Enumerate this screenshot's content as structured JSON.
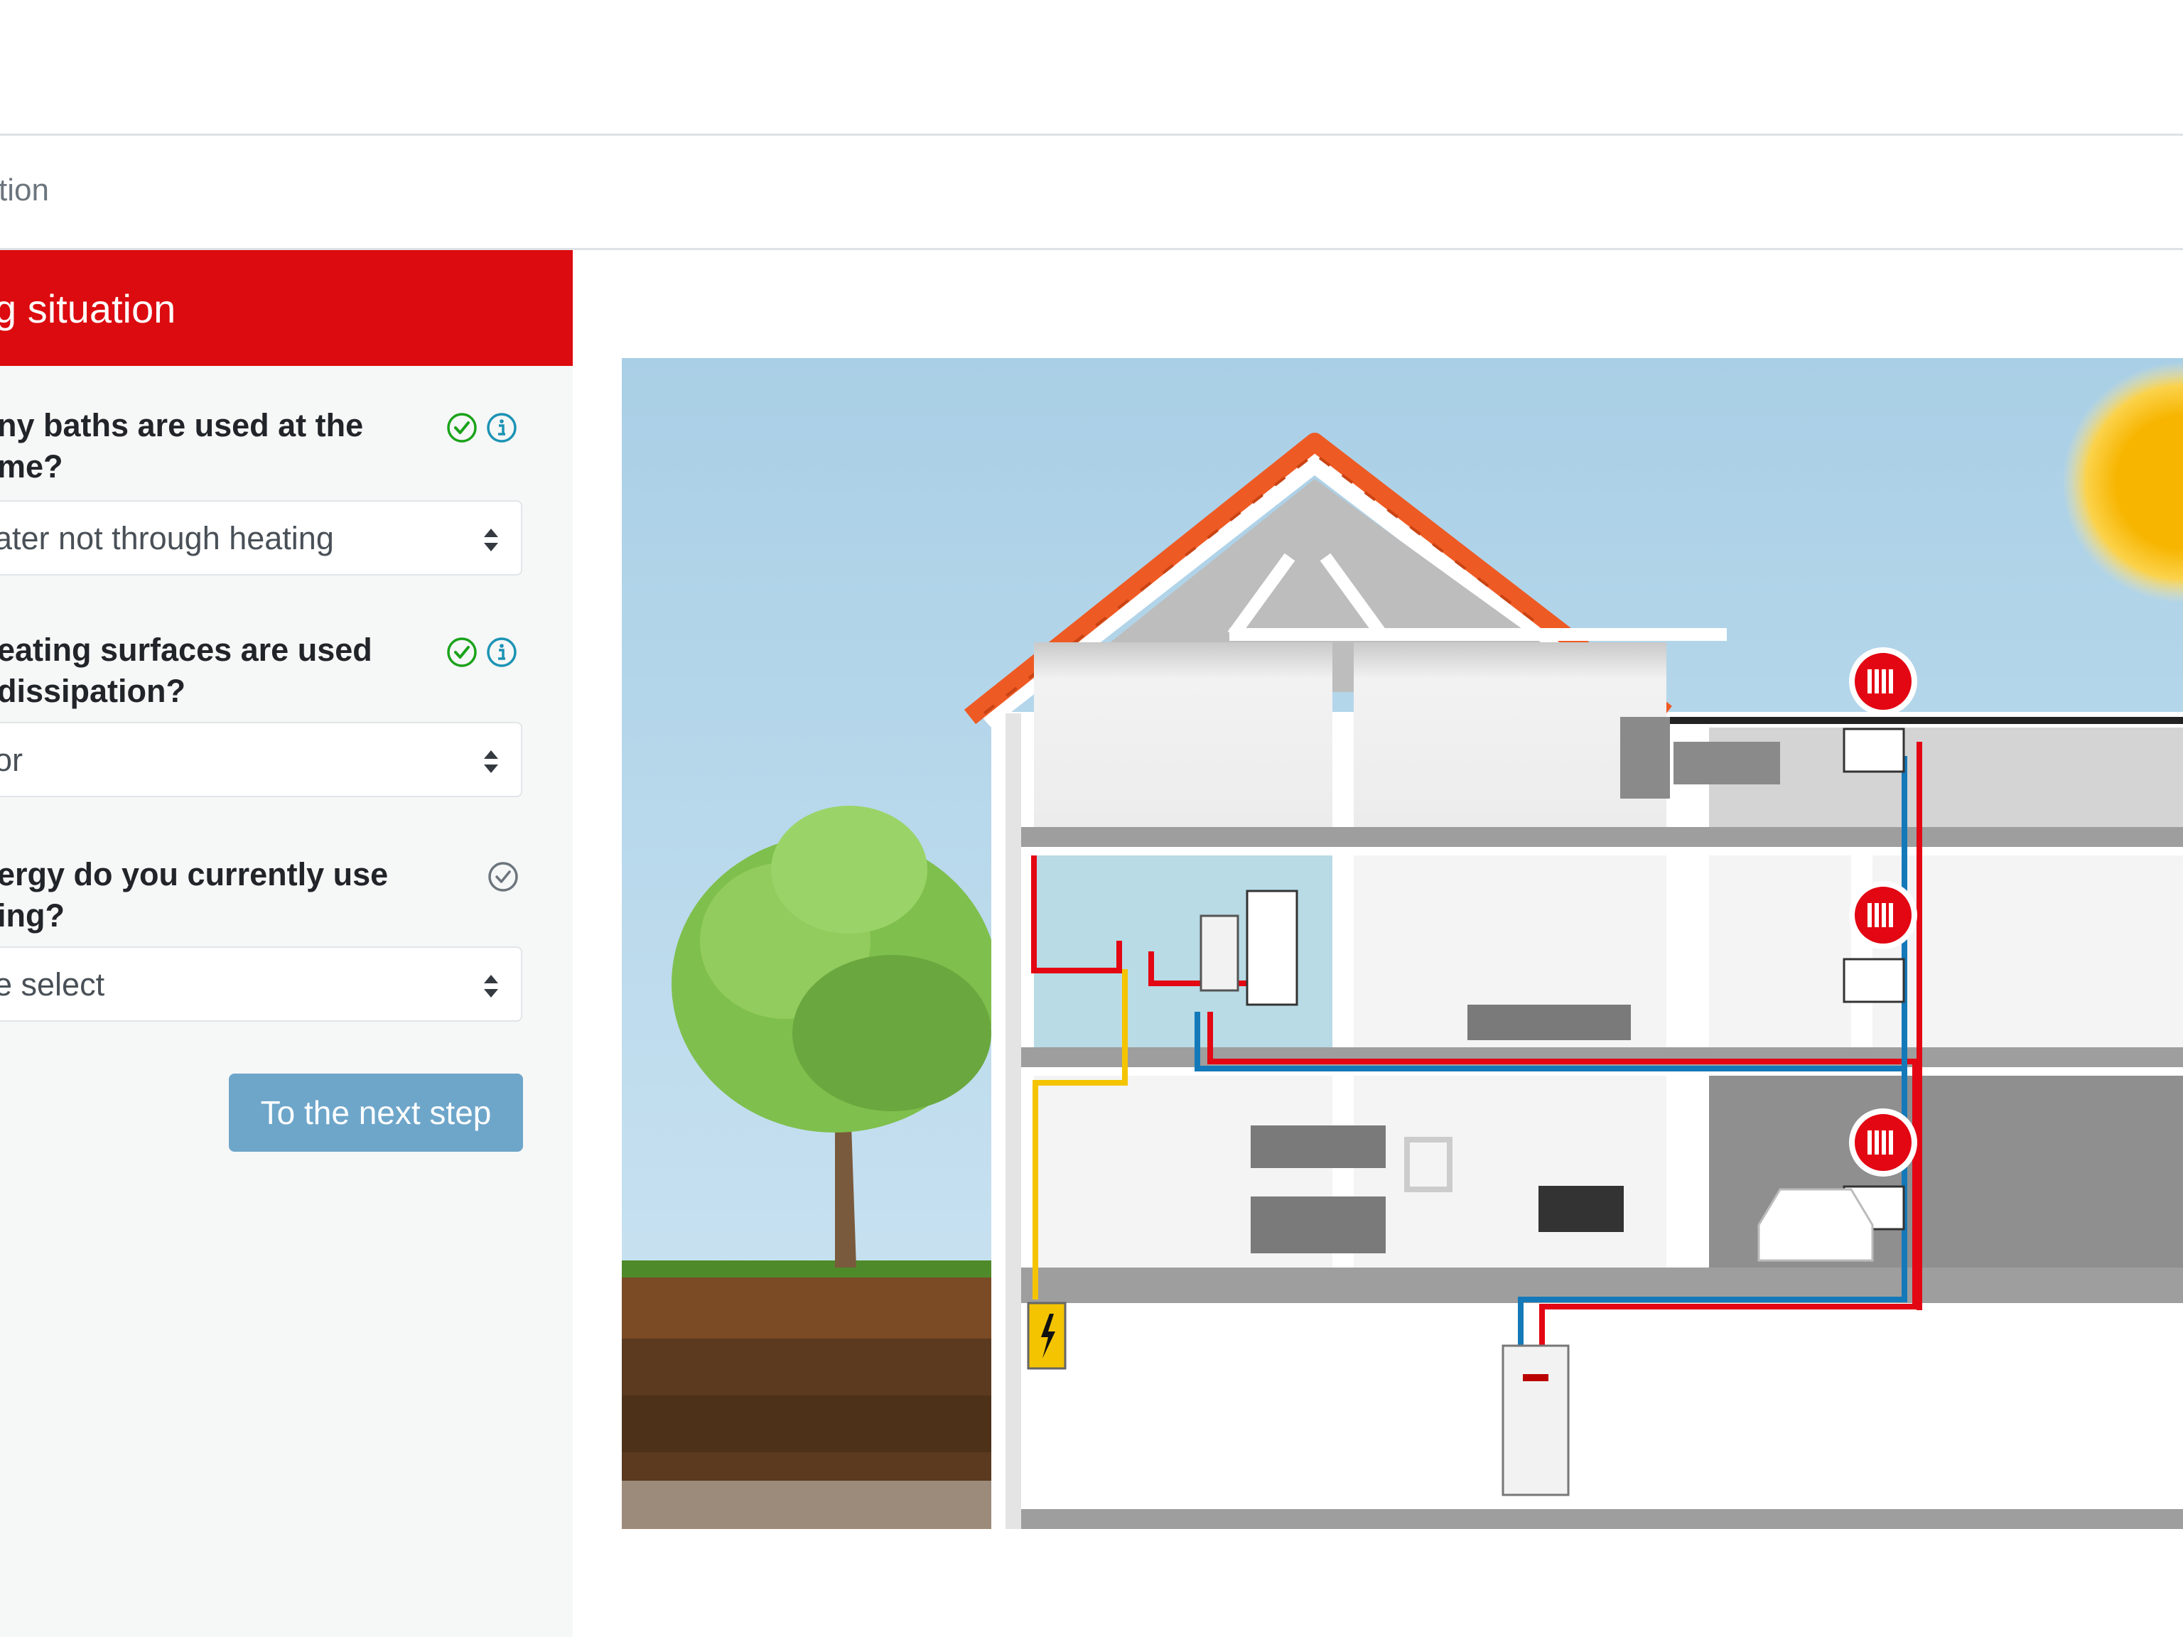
{
  "breadcrumb": {
    "current": "tion"
  },
  "panel": {
    "title": "g situation",
    "questions": [
      {
        "label_lines": [
          "ny baths are used at the",
          "me?"
        ],
        "status": "complete",
        "has_info": true,
        "selected_value": "ater not through heating"
      },
      {
        "label_lines": [
          "eating surfaces are used",
          " dissipation?"
        ],
        "status": "complete",
        "has_info": true,
        "selected_value": "or"
      },
      {
        "label_lines": [
          "ergy do you currently use",
          "ing?"
        ],
        "status": "pending",
        "has_info": false,
        "selected_value": "e select"
      }
    ],
    "next_button": "To the next step"
  },
  "colors": {
    "brand_red": "#dc0b0f",
    "check_green": "#1aa31a",
    "info_blue": "#1b93b4",
    "pending_grey": "#6c757d",
    "button_blue": "#6ea6ca",
    "pipe_hot": "#e30613",
    "pipe_cold": "#1479b8",
    "pipe_power": "#f5c400"
  },
  "illustration": {
    "description": "House cross-section showing heating system with radiators, boiler, bathroom water heater, tree, sun",
    "icons": [
      "radiator-badge-icon",
      "radiator-badge-icon",
      "radiator-badge-icon",
      "electric-hazard-icon"
    ]
  }
}
